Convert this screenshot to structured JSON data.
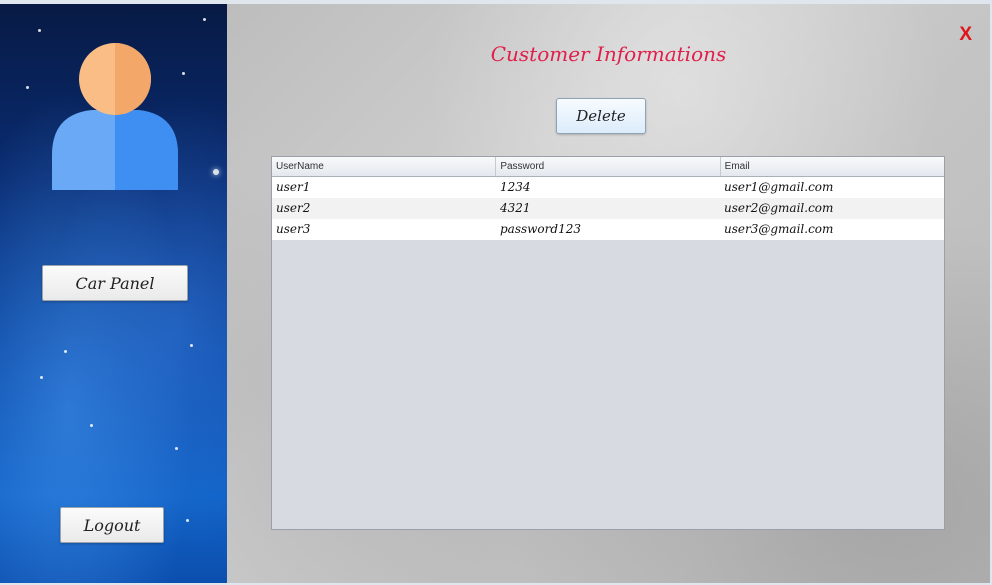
{
  "window": {
    "close_label": "X"
  },
  "sidebar": {
    "avatar_icon": "user-avatar-icon",
    "car_panel_label": "Car Panel",
    "logout_label": "Logout"
  },
  "main": {
    "title": "Customer Informations",
    "delete_label": "Delete",
    "table": {
      "columns": [
        "UserName",
        "Password",
        "Email"
      ],
      "rows": [
        [
          "user1",
          "1234",
          "user1@gmail.com"
        ],
        [
          "user2",
          "4321",
          "user2@gmail.com"
        ],
        [
          "user3",
          "password123",
          "user3@gmail.com"
        ]
      ]
    }
  },
  "colors": {
    "title": "#e01f4a",
    "close": "#e0151b",
    "avatar_head": "#f7b173",
    "avatar_body": "#3f8ef2"
  }
}
